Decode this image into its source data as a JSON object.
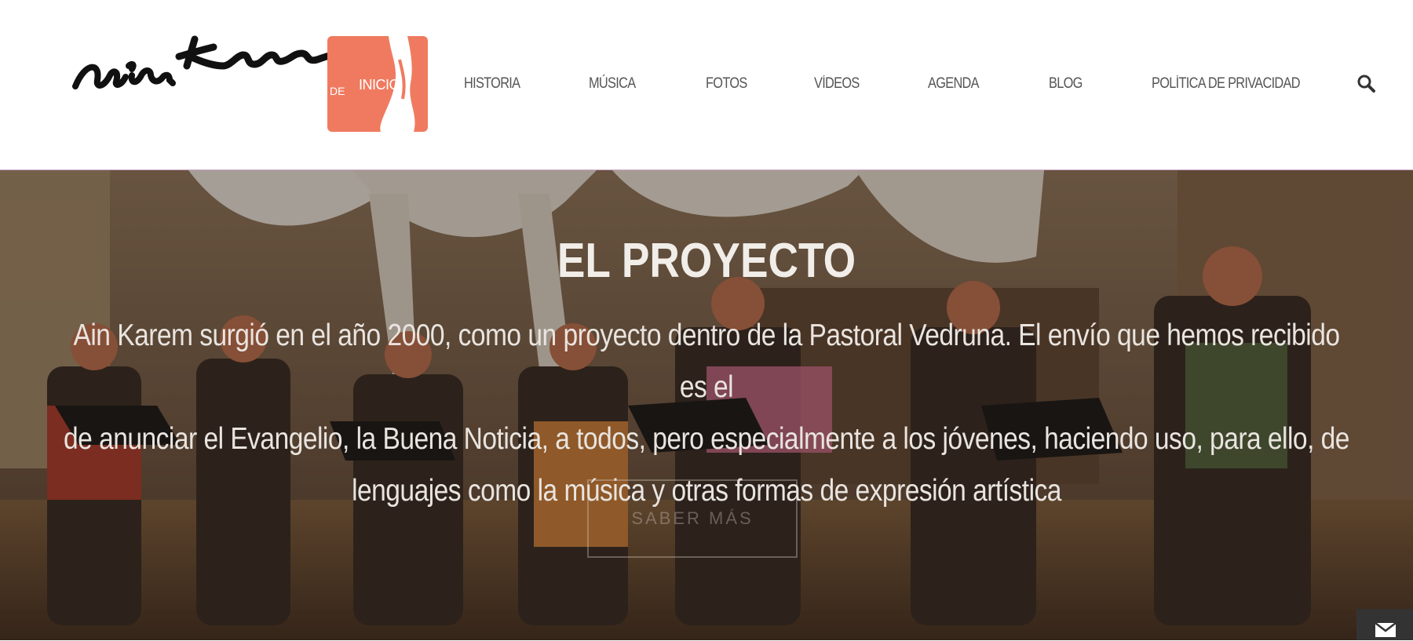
{
  "header": {
    "logo_text": "ain Karem",
    "home_tile": {
      "label": "INICIO",
      "note_text": "DE",
      "color": "#f07a5f"
    },
    "nav": [
      {
        "label": "HISTORIA"
      },
      {
        "label": "MÚSICA"
      },
      {
        "label": "FOTOS"
      },
      {
        "label": "VÍDEOS"
      },
      {
        "label": "AGENDA"
      },
      {
        "label": "BLOG"
      },
      {
        "label": "POLÍTICA DE PRIVACIDAD"
      }
    ],
    "search_icon": "search-icon"
  },
  "hero": {
    "title": "EL PROYECTO",
    "lines": [
      "Ain Karem surgió en el año 2000, como un proyecto dentro de la Pastoral Vedruna. El envío que hemos recibido es el",
      "de anunciar el Evangelio, la Buena Noticia, a todos, pero especialmente a los jóvenes, haciendo uso, para ello, de",
      "lenguajes como la música y otras formas de expresión artística"
    ],
    "button_label": "SABER MÁS"
  },
  "floating": {
    "mail_icon": "mail-icon"
  }
}
